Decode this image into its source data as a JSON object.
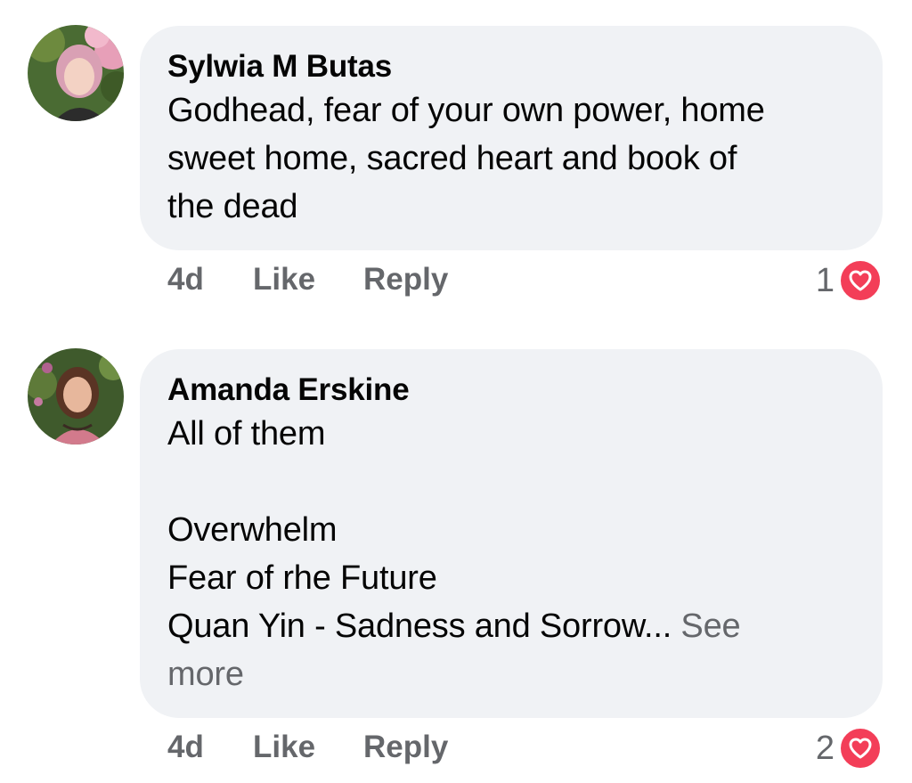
{
  "comments": [
    {
      "author": "Sylwia M Butas",
      "lines": [
        "Godhead, fear of your own power, home",
        "sweet home, sacred heart and book of",
        "the dead"
      ],
      "time": "4d",
      "like_label": "Like",
      "reply_label": "Reply",
      "reaction_count": "1",
      "reaction_icon": "heart-icon"
    },
    {
      "author": "Amanda Erskine",
      "lines": [
        "All of them",
        "",
        "Overwhelm",
        "Fear of rhe Future",
        "Quan Yin - Sadness and Sorrow..."
      ],
      "see_more_part1": "See",
      "see_more_part2": "more",
      "time": "4d",
      "like_label": "Like",
      "reply_label": "Reply",
      "reaction_count": "2",
      "reaction_icon": "heart-icon"
    }
  ],
  "colors": {
    "bubble": "#f0f2f5",
    "meta_text": "#65676b",
    "love_reaction": "#f33e58"
  }
}
